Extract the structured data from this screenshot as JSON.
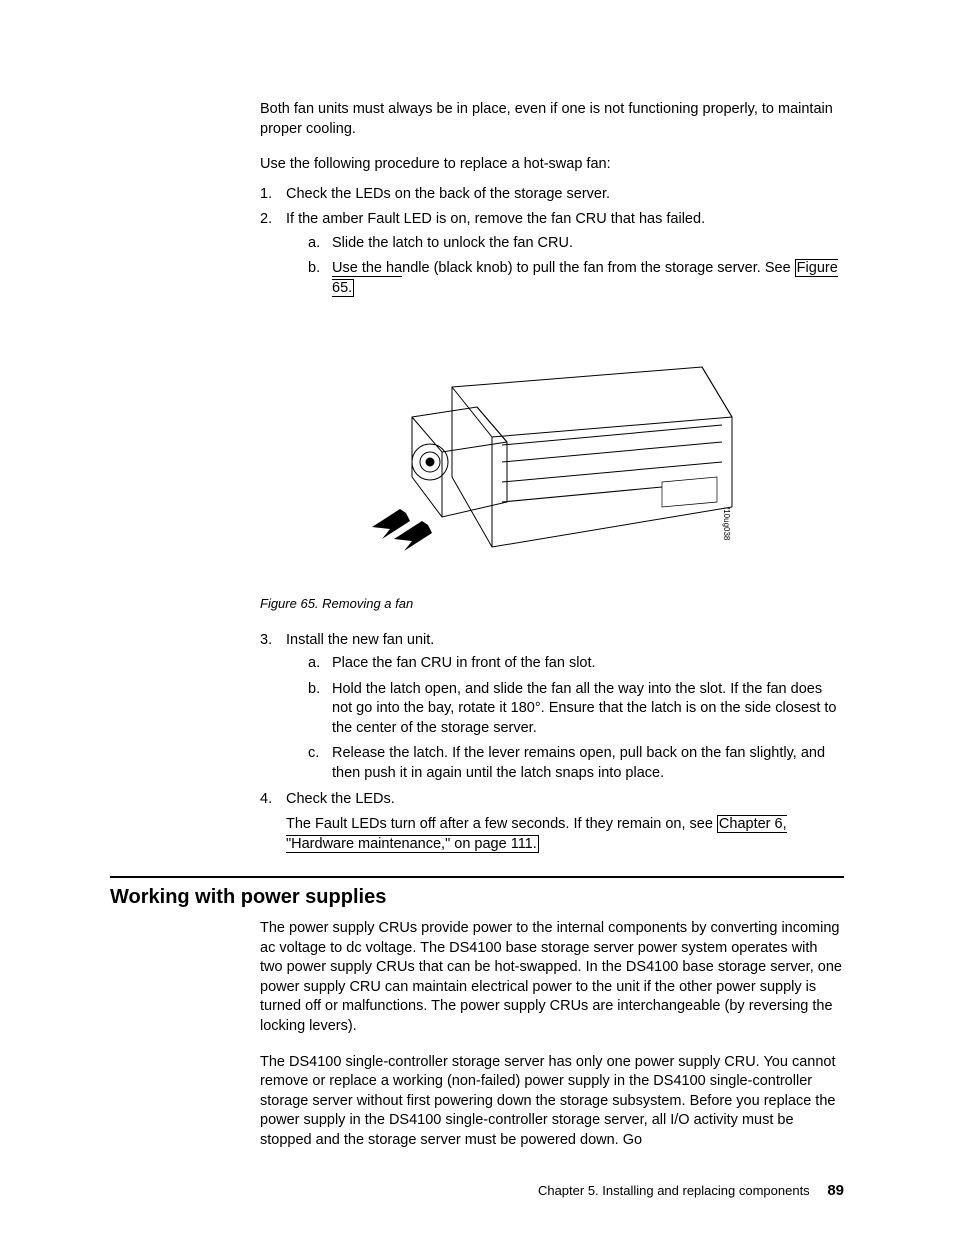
{
  "intro": {
    "p1": "Both fan units must always be in place, even if one is not functioning properly, to maintain proper cooling.",
    "p2": "Use the following procedure to replace a hot-swap fan:"
  },
  "steps_top": {
    "s1": {
      "marker": "1.",
      "text": "Check the LEDs on the back of the storage server."
    },
    "s2": {
      "marker": "2.",
      "text": "If the amber Fault LED is on, remove the fan CRU that has failed."
    },
    "s2a": {
      "marker": "a.",
      "text": "Slide the latch to unlock the fan CRU."
    },
    "s2b": {
      "marker": "b.",
      "prefix": "Use the handle (black knob) to pull the fan from the storage server. See ",
      "link": "Figure 65.",
      "boxed_prefix": "Use the ha"
    }
  },
  "figure": {
    "caption": "Figure 65. Removing a fan",
    "label": "f10ug038"
  },
  "steps_bottom": {
    "s3": {
      "marker": "3.",
      "text": "Install the new fan unit."
    },
    "s3a": {
      "marker": "a.",
      "text": "Place the fan CRU in front of the fan slot."
    },
    "s3b": {
      "marker": "b.",
      "text": "Hold the latch open, and slide the fan all the way into the slot. If the fan does not go into the bay, rotate it 180°. Ensure that the latch is on the side closest to the center of the storage server."
    },
    "s3c": {
      "marker": "c.",
      "text": "Release the latch. If the lever remains open, pull back on the fan slightly, and then push it in again until the latch snaps into place."
    },
    "s4": {
      "marker": "4.",
      "text": "Check the LEDs."
    },
    "s4p": {
      "prefix": "The Fault LEDs turn off after a few seconds. If they remain on, see ",
      "link": "Chapter 6, \"Hardware maintenance,\" on page 111.",
      "boxed_top": "The Fault LEDs turn off after a few sec"
    }
  },
  "section": {
    "heading": "Working with power supplies",
    "p1": "The power supply CRUs provide power to the internal components by converting incoming ac voltage to dc voltage. The DS4100 base storage server power system operates with two power supply CRUs that can be hot-swapped. In the DS4100 base storage server, one power supply CRU can maintain electrical power to the unit if the other power supply is turned off or malfunctions. The power supply CRUs are interchangeable (by reversing the locking levers).",
    "p2": "The DS4100 single-controller storage server has only one power supply CRU. You cannot remove or replace a working (non-failed) power supply in the DS4100 single-controller storage server without first powering down the storage subsystem. Before you replace the power supply in the DS4100 single-controller storage server, all I/O activity must be stopped and the storage server must be powered down. Go"
  },
  "footer": {
    "chapter": "Chapter 5. Installing and replacing components",
    "page": "89"
  }
}
